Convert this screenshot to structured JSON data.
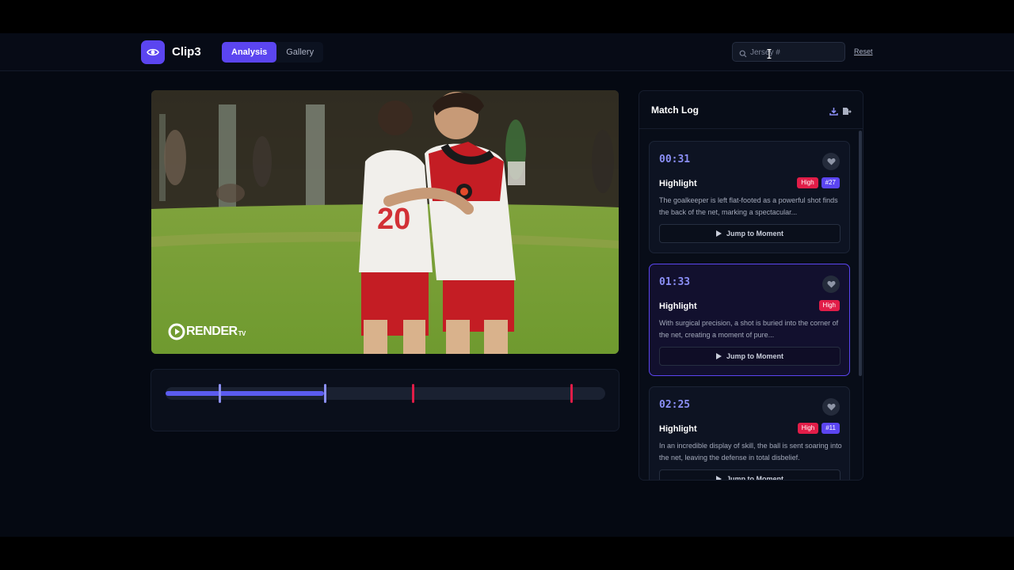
{
  "app": {
    "brand": "Clip3",
    "accent": "#5b45f0",
    "logo_icon": "eye-icon"
  },
  "nav": {
    "tabs": [
      {
        "label": "Analysis",
        "active": true
      },
      {
        "label": "Gallery",
        "active": false
      }
    ]
  },
  "search": {
    "placeholder": "Jersey #",
    "value": "",
    "icon": "search-icon"
  },
  "reset_label": "Reset",
  "video": {
    "watermark_main": "RENDER",
    "watermark_suffix": "TV"
  },
  "timeline": {
    "played_fraction": 0.36,
    "markers": [
      {
        "position": 0.12,
        "color": "#8b8ff6"
      },
      {
        "position": 0.36,
        "color": "#8b8ff6"
      },
      {
        "position": 0.56,
        "color": "#e11d48"
      },
      {
        "position": 0.92,
        "color": "#e11d48"
      }
    ]
  },
  "match_log": {
    "title": "Match Log",
    "icons": [
      "download-icon",
      "export-icon"
    ],
    "jump_label": "Jump to Moment",
    "events": [
      {
        "time": "00:31",
        "label": "Highlight",
        "priority": "High",
        "jersey": "#27",
        "description": "The goalkeeper is left flat-footed as a powerful shot finds the back of the net, marking a spectacular...",
        "selected": false
      },
      {
        "time": "01:33",
        "label": "Highlight",
        "priority": "High",
        "jersey": "",
        "description": "With surgical precision, a shot is buried into the corner of the net, creating a moment of pure...",
        "selected": true
      },
      {
        "time": "02:25",
        "label": "Highlight",
        "priority": "High",
        "jersey": "#11",
        "description": "In an incredible display of skill, the ball is sent soaring into the net, leaving the defense in total disbelief.",
        "selected": false
      }
    ]
  }
}
